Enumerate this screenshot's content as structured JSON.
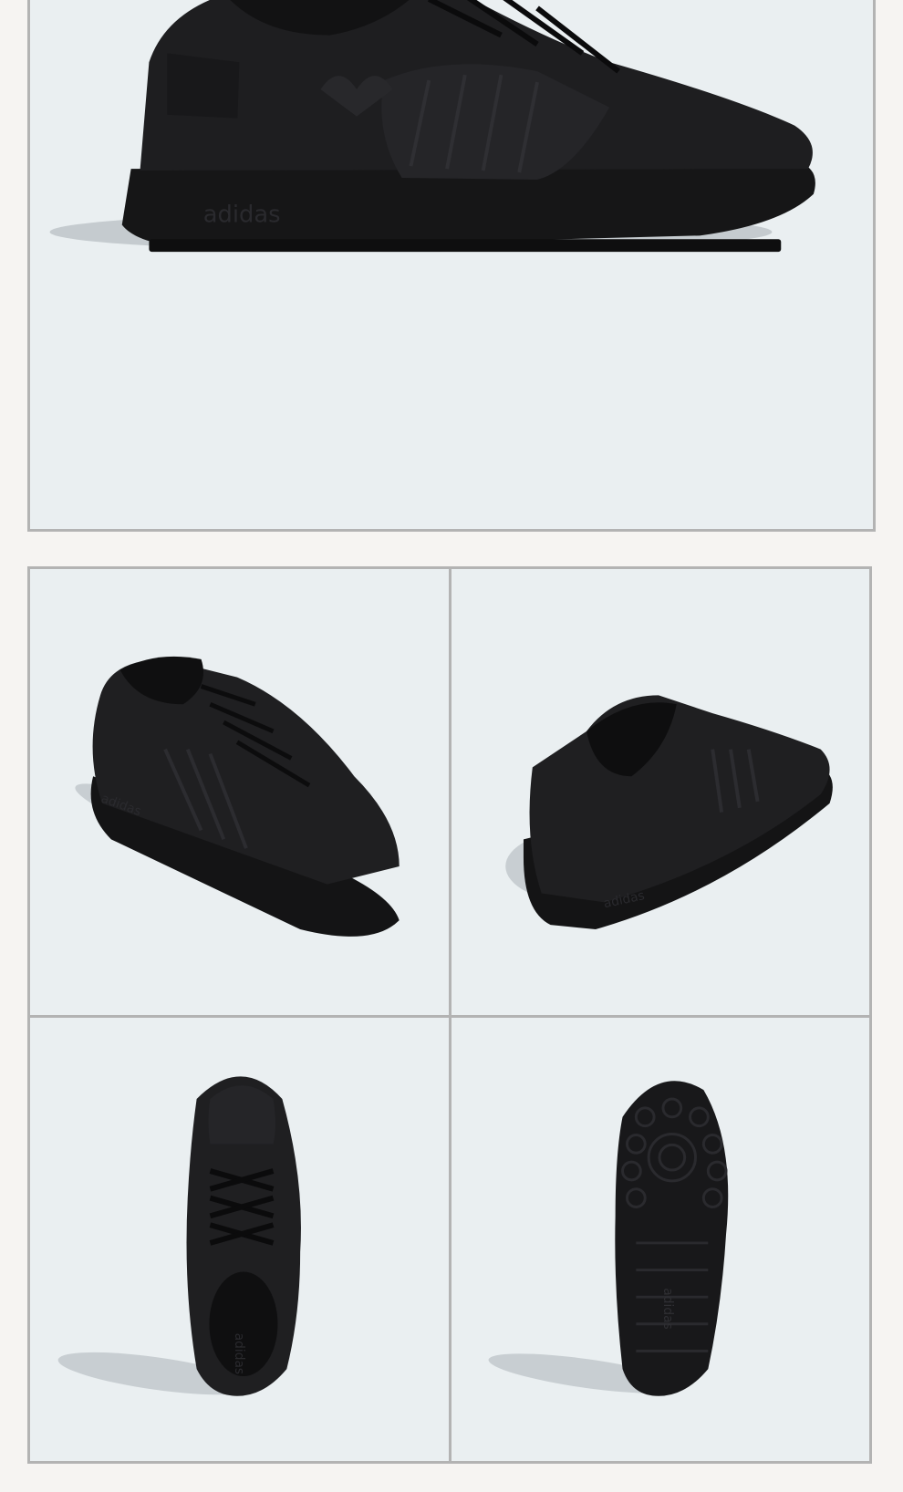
{
  "gallery": {
    "background_color": "#f6f4f2",
    "panel_color": "#eaeff1",
    "border_color": "#b3b3b3",
    "product_color": "#1c1c1e",
    "images": [
      {
        "name": "side-view",
        "icon": "shoe-side-icon",
        "branding": "adidas"
      },
      {
        "name": "front-quarter-view",
        "icon": "shoe-front-quarter-icon",
        "branding": "adidas"
      },
      {
        "name": "back-quarter-view",
        "icon": "shoe-back-quarter-icon",
        "branding": "adidas"
      },
      {
        "name": "top-view",
        "icon": "shoe-top-icon",
        "branding": "adidas"
      },
      {
        "name": "sole-view",
        "icon": "shoe-sole-icon",
        "branding": "adidas"
      }
    ]
  }
}
